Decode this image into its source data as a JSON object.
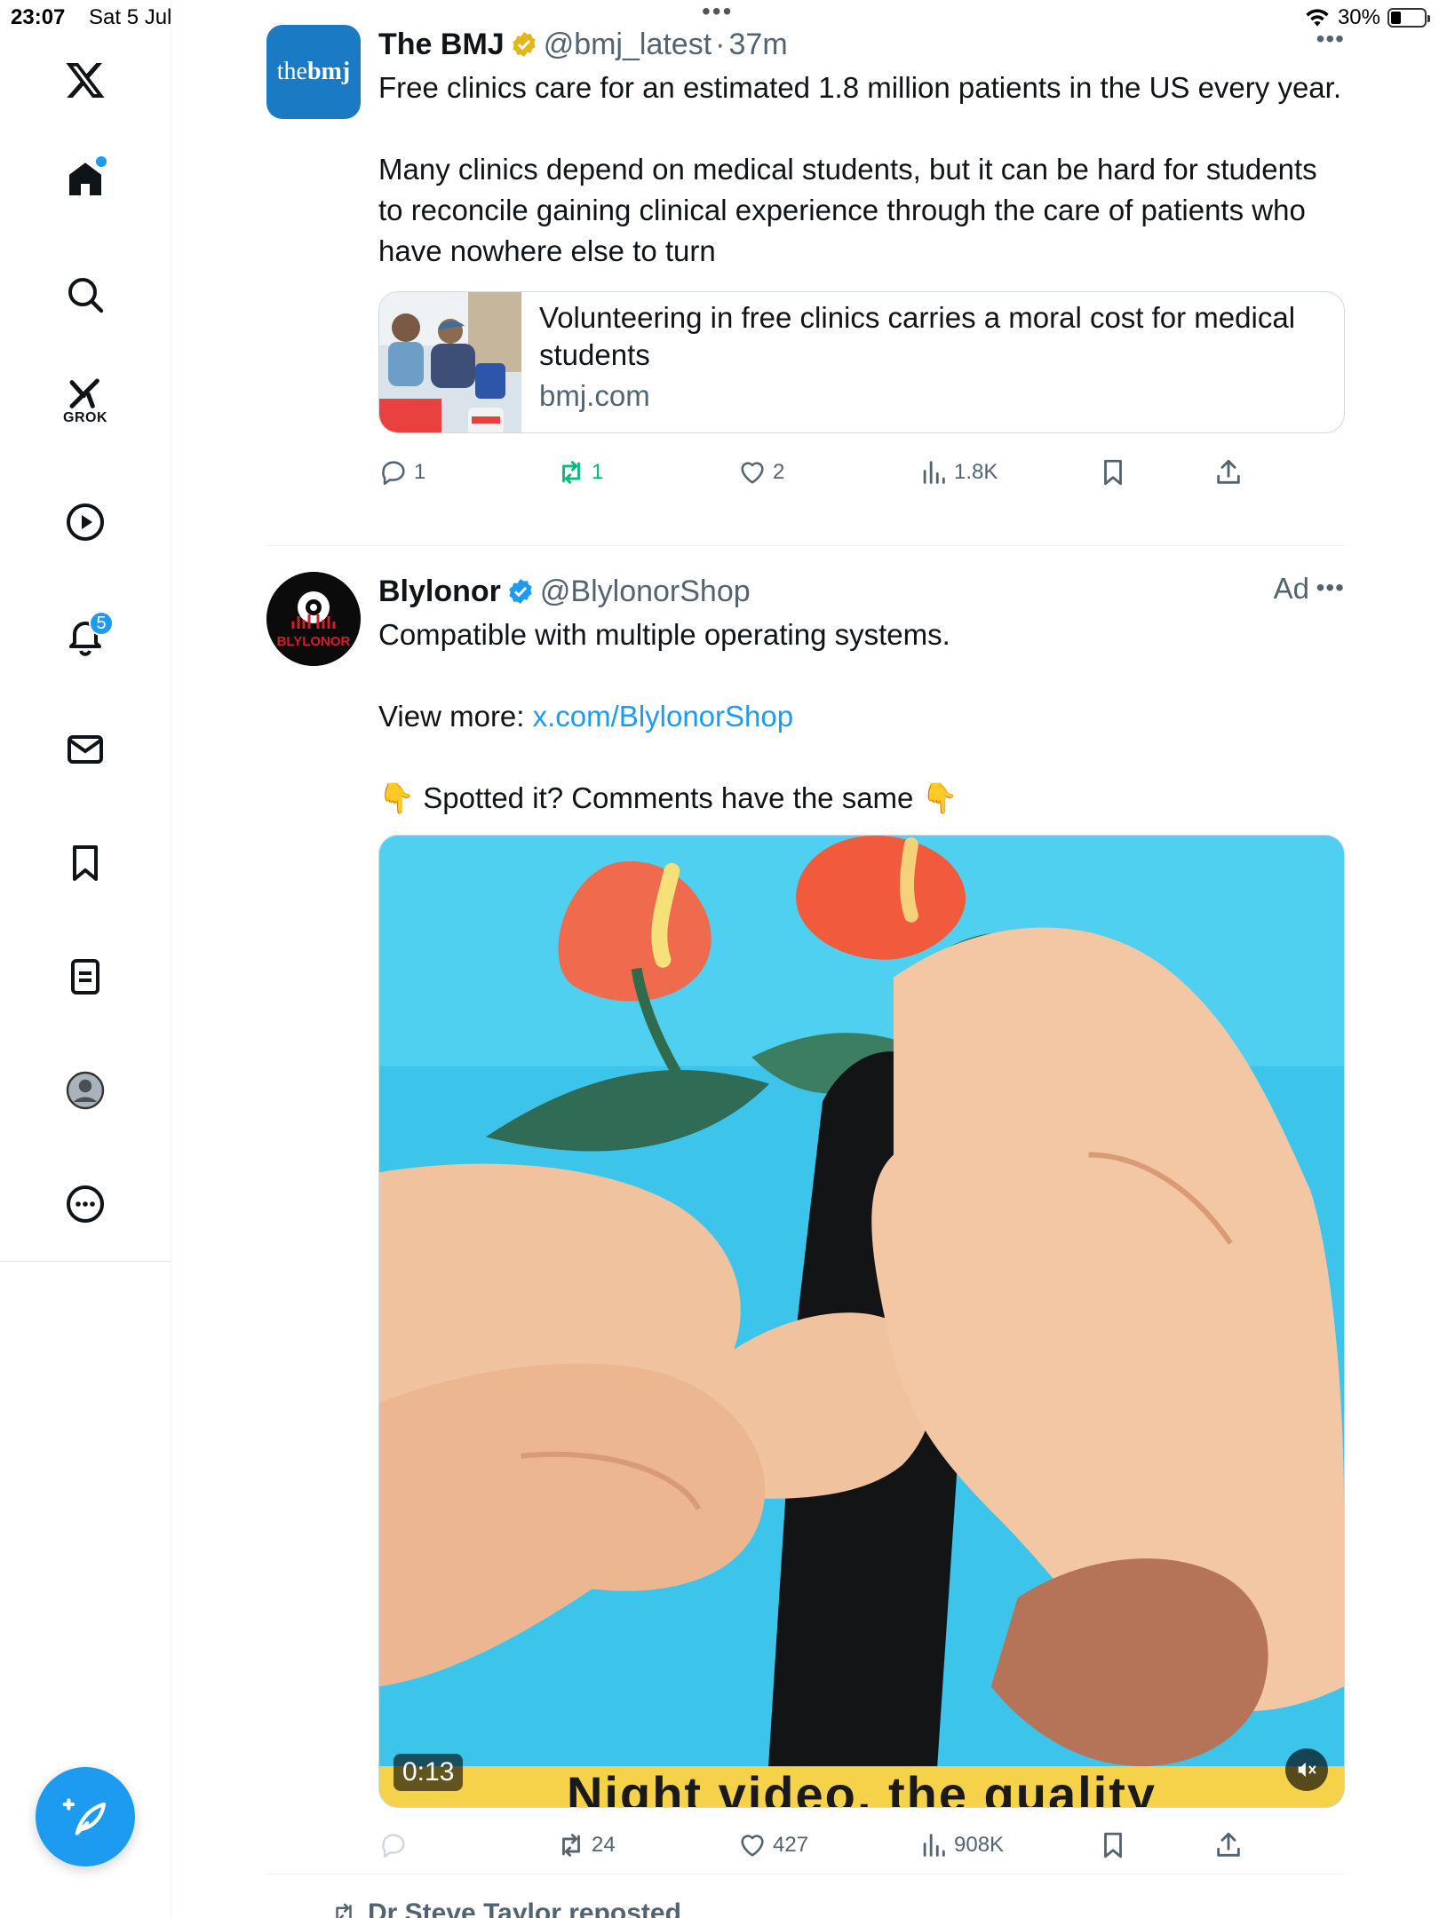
{
  "status_bar": {
    "time": "23:07",
    "date": "Sat 5 Jul",
    "battery": "30%",
    "battery_level": 0.3
  },
  "sidebar": {
    "notification_badge": "5",
    "grok_label": "GROK",
    "items": [
      "x-logo",
      "home-icon",
      "search-icon",
      "grok-icon",
      "video-icon",
      "notifications-icon",
      "messages-icon",
      "bookmarks-icon",
      "lists-icon",
      "profile-icon",
      "more-icon"
    ]
  },
  "tweets": [
    {
      "avatar_text_a": "the",
      "avatar_text_b": "bmj",
      "author": "The BMJ",
      "handle": "@bmj_latest",
      "separator": "·",
      "time": "37m",
      "paragraph_1": "Free clinics care for an estimated 1.8 million patients in the US every year.",
      "paragraph_2": "Many clinics depend on medical students, but it can be hard for students to reconcile gaining clinical experience through the care of patients who have nowhere else to turn",
      "card": {
        "title": "Volunteering in free clinics carries a moral cost for medical students",
        "domain": "bmj.com"
      },
      "replies": "1",
      "reposts": "1",
      "likes": "2",
      "views": "1.8K"
    },
    {
      "avatar_text": "BLYLONOR",
      "author": "Blylonor",
      "handle": "@BlylonorShop",
      "ad_label": "Ad",
      "paragraph_1": "Compatible with multiple operating systems.",
      "view_more_label": "View more: ",
      "view_more_link": "x.com/BlylonorShop",
      "spotted_emoji": "👇",
      "spotted_text": "Spotted it? Comments have the same",
      "video": {
        "duration": "0:13",
        "caption": "Night video, the quality"
      },
      "reposts": "24",
      "likes": "427",
      "views": "908K"
    }
  ],
  "next_item": {
    "repost_label": "Dr Steve Taylor reposted"
  },
  "colors": {
    "accent": "#1d9bf0",
    "repost_green": "#00ba7c",
    "secondary_text": "#536471",
    "gold_verified": "#e2b719"
  }
}
